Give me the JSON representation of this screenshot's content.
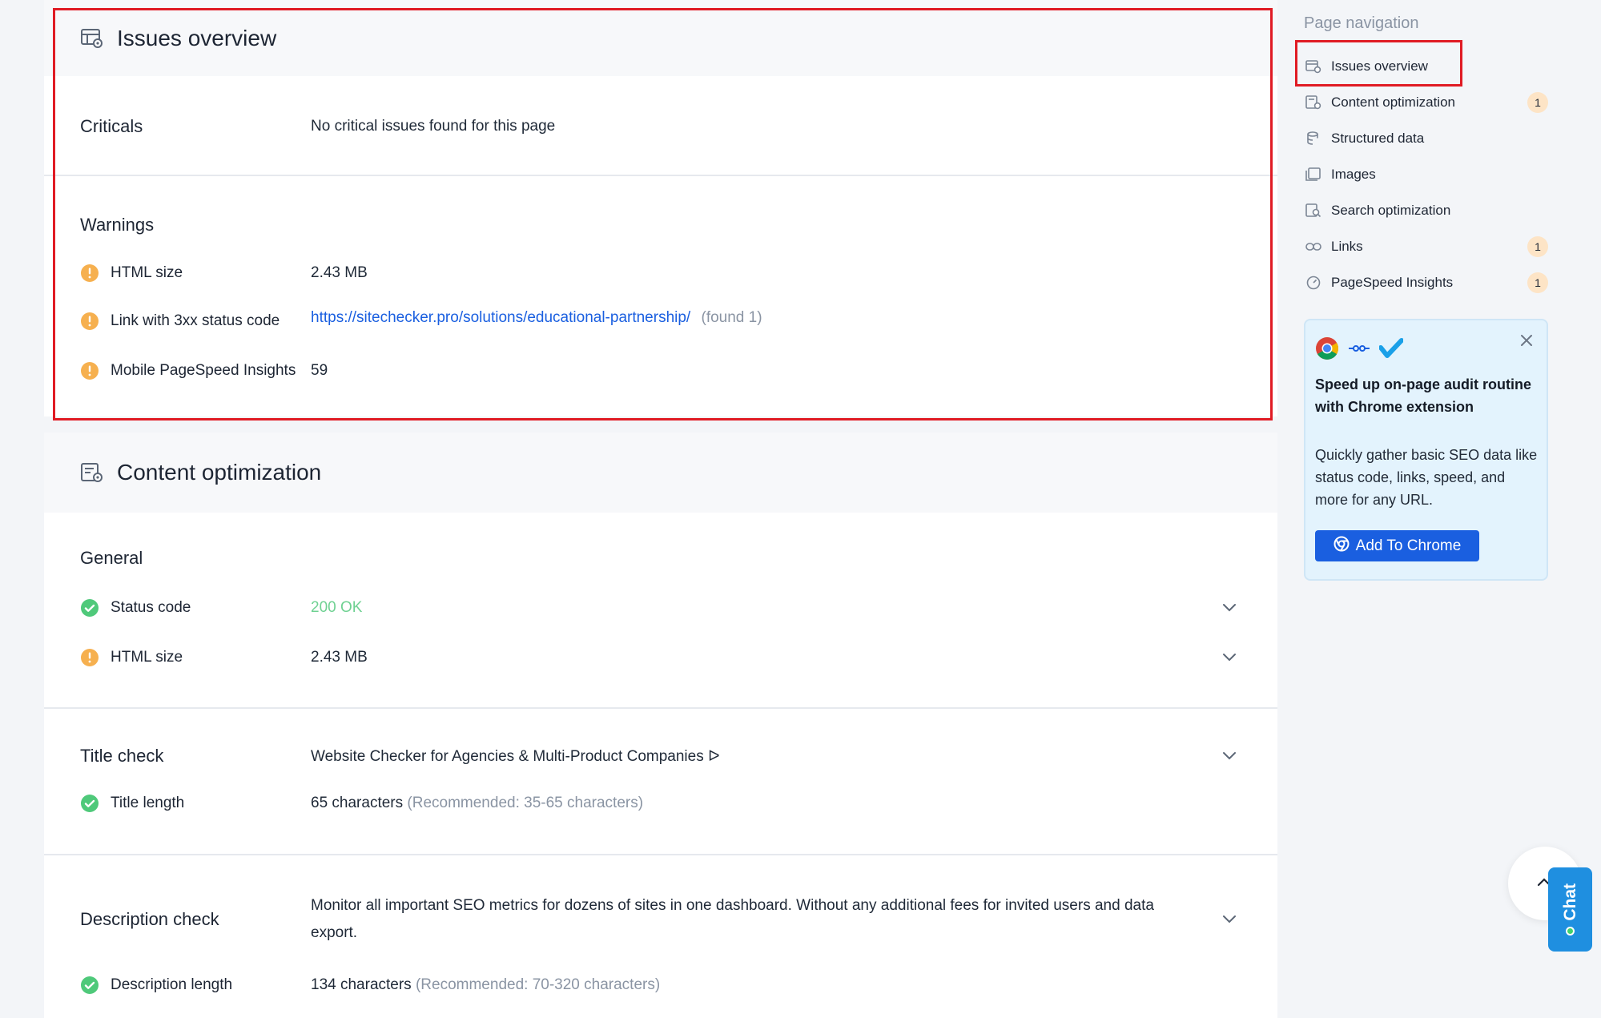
{
  "issues_overview": {
    "title": "Issues overview",
    "criticals_label": "Criticals",
    "criticals_value": "No critical issues found for this page",
    "warnings_label": "Warnings",
    "warnings": [
      {
        "label": "HTML size",
        "value": "2.43 MB"
      },
      {
        "label": "Link with 3xx status code",
        "link": "https://sitechecker.pro/solutions/educational-partnership/",
        "note": "(found 1)"
      },
      {
        "label": "Mobile PageSpeed Insights",
        "value": "59"
      }
    ]
  },
  "content_optimization": {
    "title": "Content optimization",
    "general": {
      "label": "General",
      "rows": [
        {
          "label": "Status code",
          "value": "200 OK",
          "status": "ok"
        },
        {
          "label": "HTML size",
          "value": "2.43 MB",
          "status": "warning"
        }
      ]
    },
    "title_check": {
      "label": "Title check",
      "value": "Website Checker for Agencies & Multi-Product Companies ᐅ",
      "length_label": "Title length",
      "length_value": "65 characters",
      "length_recommended": "(Recommended: 35-65 characters)"
    },
    "description_check": {
      "label": "Description check",
      "value": "Monitor all important SEO metrics for dozens of sites in one dashboard. Without any additional fees for invited users and data export.",
      "length_label": "Description length",
      "length_value": "134 characters",
      "length_recommended": "(Recommended: 70-320 characters)"
    }
  },
  "sidebar": {
    "title": "Page navigation",
    "items": [
      {
        "label": "Issues overview",
        "icon": "issues-overview-icon",
        "badge": ""
      },
      {
        "label": "Content optimization",
        "icon": "content-optimization-icon",
        "badge": "1"
      },
      {
        "label": "Structured data",
        "icon": "database-icon",
        "badge": ""
      },
      {
        "label": "Images",
        "icon": "images-icon",
        "badge": ""
      },
      {
        "label": "Search optimization",
        "icon": "search-optimization-icon",
        "badge": ""
      },
      {
        "label": "Links",
        "icon": "link-icon",
        "badge": "1"
      },
      {
        "label": "PageSpeed Insights",
        "icon": "speedometer-icon",
        "badge": "1"
      }
    ]
  },
  "promo": {
    "title": "Speed up on-page audit routine with Chrome extension",
    "text": "Quickly gather basic SEO data like status code, links, speed, and more for any URL.",
    "button_label": "Add To Chrome"
  },
  "chat": {
    "label": "Chat"
  },
  "colors": {
    "accent": "#1a5fe0",
    "warning": "#f6b04f",
    "ok": "#4fc97a",
    "badge_bg": "#fde4c6",
    "highlight": "#e01b24",
    "chat_bg": "#1f8fe0"
  }
}
